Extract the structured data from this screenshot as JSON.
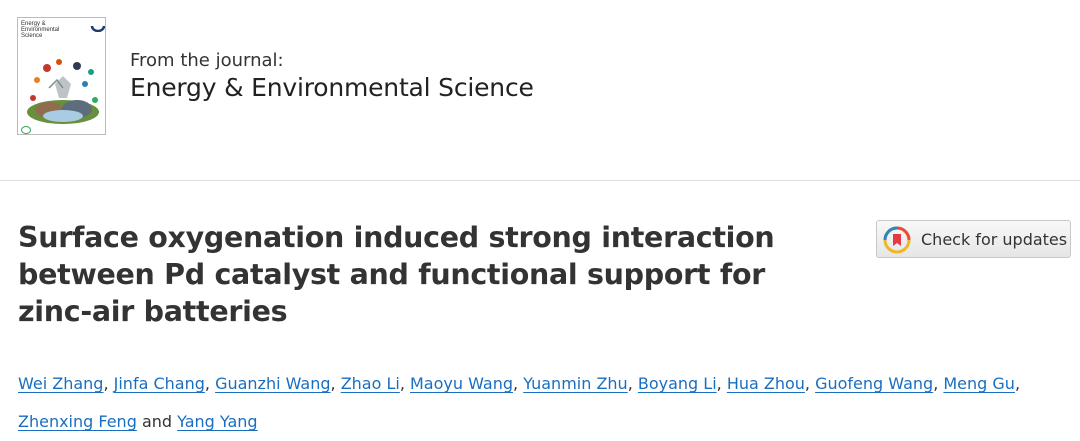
{
  "journal": {
    "cover_title": "Energy & Environmental Science",
    "from_label": "From the journal:",
    "name": "Energy & Environmental Science"
  },
  "article": {
    "title": "Surface oxygenation induced strong interaction between Pd catalyst and functional support for zinc-air batteries",
    "check_updates_label": "Check for updates",
    "authors": [
      "Wei Zhang",
      "Jinfa Chang",
      "Guanzhi Wang",
      "Zhao Li",
      "Maoyu Wang",
      "Yuanmin Zhu",
      "Boyang Li",
      "Hua Zhou",
      "Guofeng Wang",
      "Meng Gu",
      "Zhenxing Feng",
      "Yang Yang"
    ],
    "authors_conjunction": "and"
  },
  "colors": {
    "link": "#1a6ec1",
    "divider": "#dedede"
  },
  "icons": [
    "journal-cover-image",
    "crossmark-icon"
  ]
}
